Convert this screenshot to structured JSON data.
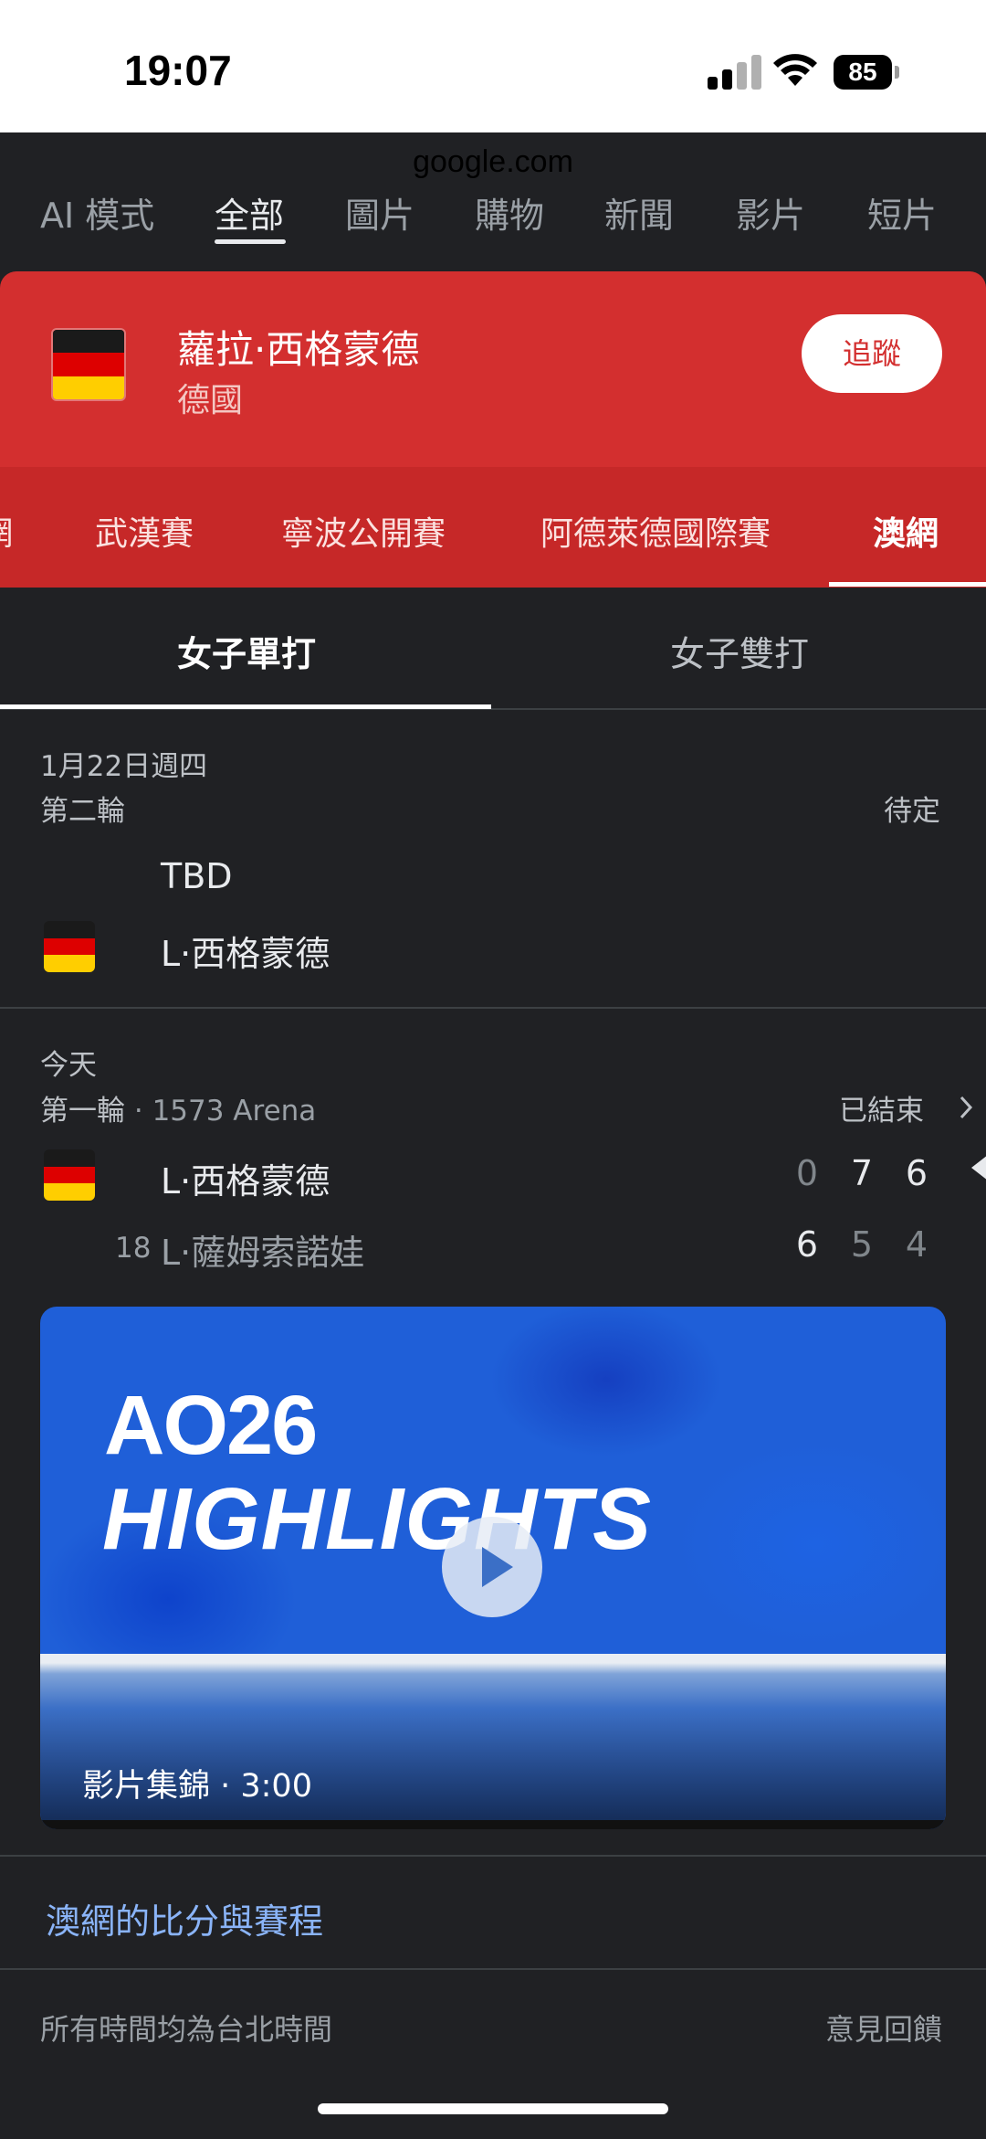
{
  "status": {
    "time": "19:07",
    "battery": "85",
    "url": "google.com"
  },
  "search_tabs": [
    "AI 模式",
    "全部",
    "圖片",
    "購物",
    "新聞",
    "影片",
    "短片"
  ],
  "player": {
    "name": "蘿拉·西格蒙德",
    "country": "德國",
    "follow_label": "追蹤"
  },
  "tournaments": [
    "網",
    "武漢賽",
    "寧波公開賽",
    "阿德萊德國際賽",
    "澳網"
  ],
  "draw_tabs": [
    "女子單打",
    "女子雙打"
  ],
  "match1": {
    "date": "1月22日週四",
    "round": "第二輪",
    "status": "待定",
    "player_a": "TBD",
    "player_b": "L·西格蒙德"
  },
  "match2": {
    "date": "今天",
    "round": "第一輪",
    "separator": " · ",
    "venue": "1573 Arena",
    "status": "已結束",
    "player_a": {
      "name": "L·西格蒙德",
      "scores": [
        "0",
        "7",
        "6"
      ]
    },
    "player_b": {
      "seed": "18",
      "name": "L·薩姆索諾娃",
      "scores": [
        "6",
        "5",
        "4"
      ]
    }
  },
  "video": {
    "logo": "AO26",
    "title": "HIGHLIGHTS",
    "caption": "影片集錦 · 3:00"
  },
  "link_label": "澳網的比分與賽程",
  "footer": {
    "timezone_note": "所有時間均為台北時間",
    "feedback": "意見回饋"
  }
}
